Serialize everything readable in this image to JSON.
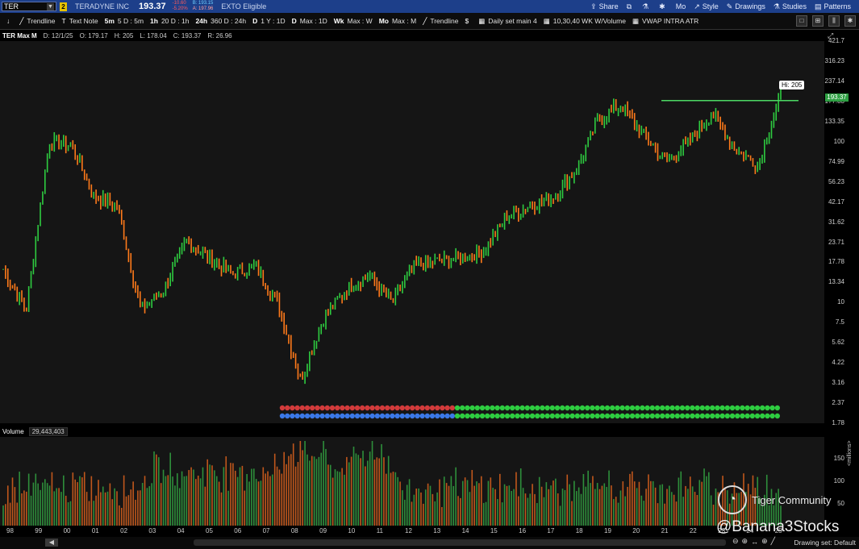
{
  "topbar": {
    "symbol": "TER",
    "link_badge": "2",
    "company": "TERADYNE INC",
    "last": "193.37",
    "change": "-10.60",
    "change_pct": "-5.20%",
    "bid": "B: 193.15",
    "ask": "A: 197.96",
    "exto": "EXTO Eligible",
    "share": "Share",
    "mo": "Mo",
    "style": "Style",
    "drawings": "Drawings",
    "studies": "Studies",
    "patterns": "Patterns"
  },
  "toolbar": {
    "trendline1": "Trendline",
    "textnote": "Text Note",
    "p5m_key": "5m",
    "p5m_label": "5 D : 5m",
    "p1h_key": "1h",
    "p1h_label": "20 D : 1h",
    "p24h_key": "24h",
    "p24h_label": "360 D : 24h",
    "d1_key": "D",
    "d1_label": "1 Y : 1D",
    "dmax_key": "D",
    "dmax_label": "Max : 1D",
    "wk_key": "Wk",
    "wk_label": "Max : W",
    "mo_key": "Mo",
    "mo_label": "Max : M",
    "trendline2": "Trendline",
    "dailyset": "Daily set main 4",
    "ma": "10,30,40 WK W/Volume",
    "vwap": "VWAP INTRA ATR"
  },
  "header": {
    "name": "TER Max M",
    "date": "D: 12/1/25",
    "open": "O: 179.17",
    "high": "H: 205",
    "low": "L: 178.04",
    "close": "C: 193.37",
    "range": "R: 26.96"
  },
  "yaxis_labels": [
    "421.7",
    "316.23",
    "237.14",
    "177.83",
    "133.35",
    "100",
    "74.99",
    "56.23",
    "42.17",
    "31.62",
    "23.71",
    "17.78",
    "13.34",
    "10",
    "7.5",
    "5.62",
    "4.22",
    "3.16",
    "2.37",
    "1.78"
  ],
  "price_tag": "193.37",
  "hi_tag": "Hi: 205",
  "volume": {
    "label": "Volume",
    "value": "29,443,403",
    "axis": [
      "150",
      "100",
      "50"
    ],
    "unit": "<millions>"
  },
  "xaxis_labels": [
    "98",
    "99",
    "00",
    "01",
    "02",
    "03",
    "04",
    "05",
    "06",
    "07",
    "08",
    "09",
    "10",
    "11",
    "12",
    "13",
    "14",
    "15",
    "16",
    "17",
    "18",
    "19",
    "20",
    "21",
    "22",
    "23",
    "24",
    "25"
  ],
  "footer": {
    "drawing_set": "Drawing set: Default"
  },
  "watermark": {
    "brand": "Tiger Community",
    "user": "@Banana3Stocks"
  },
  "colors": {
    "up": "#2ecc40",
    "down": "#ff7a1a",
    "hline": "#4cd964",
    "topbar": "#1d3f8a"
  },
  "chart_data": {
    "type": "bar",
    "title": "TER Max M",
    "scale": "log",
    "ylim": [
      1.78,
      421.7
    ],
    "x": [
      "1998",
      "1999",
      "2000",
      "2000-09",
      "2001",
      "2002",
      "2002-10",
      "2003",
      "2004",
      "2005",
      "2006",
      "2007",
      "2008",
      "2008-11",
      "2009",
      "2010",
      "2011",
      "2012",
      "2013",
      "2014",
      "2015",
      "2016",
      "2017",
      "2018",
      "2019",
      "2020",
      "2021",
      "2021-12",
      "2022",
      "2022-10",
      "2023",
      "2024",
      "2024-06",
      "2025-04",
      "2025-12"
    ],
    "series": [
      {
        "values": [
          16,
          9,
          100,
          95,
          45,
          40,
          9,
          12,
          24,
          19,
          15,
          17,
          10,
          3.3,
          8,
          12,
          15,
          10,
          17,
          18,
          19,
          21,
          34,
          40,
          45,
          65,
          135,
          170,
          110,
          75,
          100,
          150,
          90,
          72,
          193.37
        ]
      }
    ],
    "hline": 180
  }
}
